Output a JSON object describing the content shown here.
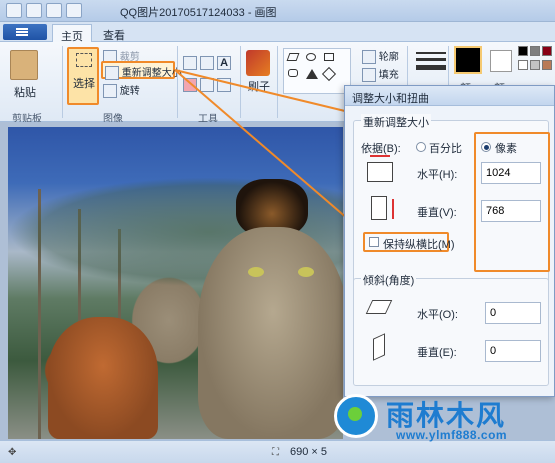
{
  "window": {
    "title": "QQ图片20170517124033 - 画图"
  },
  "tabs": [
    {
      "label": "主页"
    },
    {
      "label": "查看"
    }
  ],
  "ribbon": {
    "clipboard": {
      "paste": "粘贴",
      "group": "剪贴板"
    },
    "image": {
      "select": "选择",
      "crop": "裁剪",
      "resize": "重新调整大小",
      "rotate": "旋转",
      "group": "图像"
    },
    "tools": {
      "group": "工具"
    },
    "brush": {
      "label": "刷子"
    },
    "shapes": {
      "outline": "轮廓",
      "fill": "填充",
      "group": "形"
    },
    "colors": {
      "size": "粗",
      "color1": "颜",
      "color2": "颜"
    }
  },
  "dialog": {
    "title": "调整大小和扭曲",
    "resize_section": "重新调整大小",
    "by_label": "依据(B):",
    "percent_label": "百分比",
    "pixels_label": "像素",
    "horizontal_label": "水平(H):",
    "horizontal_value": "1024",
    "vertical_label": "垂直(V):",
    "vertical_value": "768",
    "keep_ratio_label": "保持纵横比(M)",
    "skew_section": "倾斜(角度)",
    "skew_h_label": "水平(O):",
    "skew_h_value": "0",
    "skew_v_label": "垂直(E):",
    "skew_v_value": "0"
  },
  "statusbar": {
    "dimensions": "690 × 5"
  },
  "watermark": {
    "title": "雨林木风",
    "url": "www.ylmf888.com"
  },
  "colors": {
    "highlight": "#f08a2a",
    "accent": "#1e7cd0"
  }
}
